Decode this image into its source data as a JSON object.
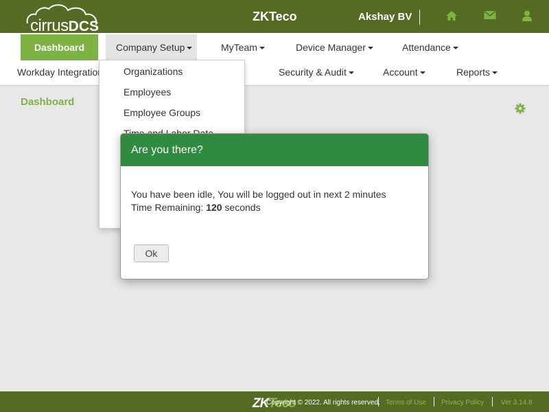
{
  "header": {
    "logo_text_light": "cirrus",
    "logo_text_bold": "DCS",
    "brand": "ZKTeco",
    "user_name": "Akshay BV",
    "icons": [
      "home-icon",
      "envelope-icon",
      "user-icon"
    ]
  },
  "nav": {
    "row1": [
      {
        "label": "Dashboard"
      },
      {
        "label": "Company Setup"
      },
      {
        "label": "MyTeam"
      },
      {
        "label": "Device Manager"
      },
      {
        "label": "Attendance"
      }
    ],
    "row2": [
      {
        "label": "Workday Integration"
      },
      {
        "label": "Security & Audit"
      },
      {
        "label": "Account"
      },
      {
        "label": "Reports"
      }
    ]
  },
  "dropdown": {
    "items": [
      "Organizations",
      "Employees",
      "Employee Groups",
      "Time and Labor Data"
    ]
  },
  "main": {
    "title": "Dashboard"
  },
  "modal": {
    "title": "Are you there?",
    "message": "You have been idle, You will be logged out in next 2 minutes",
    "remaining_prefix": "Time Remaining: ",
    "remaining_value": "120",
    "remaining_suffix": " seconds",
    "ok_label": "Ok"
  },
  "footer": {
    "logo_zk": "ZK",
    "logo_teco": "Teco",
    "copyright": "Copyright © 2022. All rights reserved.",
    "terms": "Terms of Use",
    "privacy": "Privacy Policy",
    "version": "Ver 3.14.8"
  },
  "colors": {
    "header_bg": "#556b24",
    "accent_green": "#7cb342",
    "modal_header": "#2e8b3f"
  }
}
